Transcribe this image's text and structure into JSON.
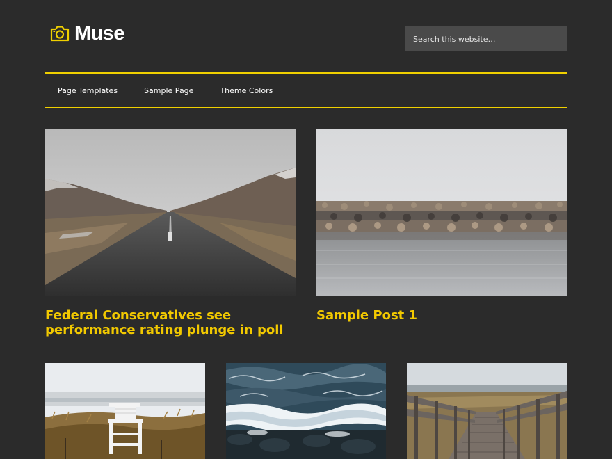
{
  "header": {
    "site_title": "Muse",
    "search_placeholder": "Search this website…",
    "accent_color": "#f0d000"
  },
  "nav": {
    "items": [
      {
        "label": "Page Templates"
      },
      {
        "label": "Sample Page"
      },
      {
        "label": "Theme Colors"
      }
    ]
  },
  "posts": [
    {
      "title": "Federal Conservatives see performance rating plunge in poll",
      "image": "road-through-valley-photo"
    },
    {
      "title": "Sample Post 1",
      "image": "rock-breakwater-water-photo"
    },
    {
      "title": "",
      "image": "beach-lifeguard-chair-photo"
    },
    {
      "title": "",
      "image": "ocean-waves-rocks-photo"
    },
    {
      "title": "",
      "image": "wooden-boardwalk-photo"
    }
  ]
}
